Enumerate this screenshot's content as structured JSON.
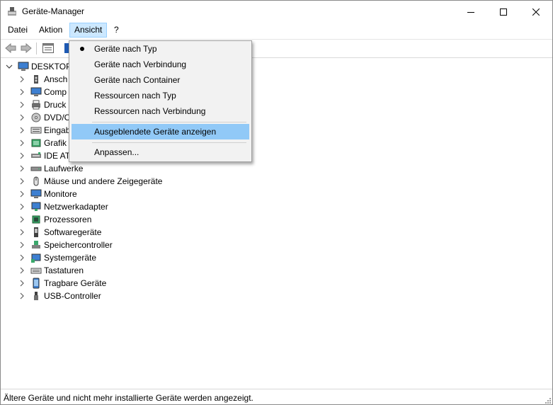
{
  "window": {
    "title": "Geräte-Manager"
  },
  "menubar": {
    "items": [
      "Datei",
      "Aktion",
      "Ansicht",
      "?"
    ]
  },
  "menu_open": {
    "name": "Ansicht",
    "items": [
      {
        "label": "Geräte nach Typ",
        "checked": true
      },
      {
        "label": "Geräte nach Verbindung"
      },
      {
        "label": "Geräte nach Container"
      },
      {
        "label": "Ressourcen nach Typ"
      },
      {
        "label": "Ressourcen nach Verbindung"
      },
      {
        "label": "Ausgeblendete Geräte anzeigen",
        "highlighted": true
      },
      {
        "label": "Anpassen..."
      }
    ]
  },
  "tree": {
    "root": {
      "label": "DESKTOP-",
      "icon": "computer-icon"
    },
    "children": [
      {
        "label": "Ansch",
        "icon": "audio-io-icon"
      },
      {
        "label": "Comp",
        "icon": "monitor-icon"
      },
      {
        "label": "Druck",
        "icon": "printer-icon"
      },
      {
        "label": "DVD/C",
        "icon": "dvd-drive-icon"
      },
      {
        "label": "Eingab",
        "icon": "input-device-icon"
      },
      {
        "label": "Grafik",
        "icon": "display-adapter-icon"
      },
      {
        "label": "IDE AT",
        "icon": "ide-controller-icon"
      },
      {
        "label": "Laufwerke",
        "icon": "disk-drive-icon"
      },
      {
        "label": "Mäuse und andere Zeigegeräte",
        "icon": "mouse-icon"
      },
      {
        "label": "Monitore",
        "icon": "monitor-icon"
      },
      {
        "label": "Netzwerkadapter",
        "icon": "network-adapter-icon"
      },
      {
        "label": "Prozessoren",
        "icon": "processor-icon"
      },
      {
        "label": "Softwaregeräte",
        "icon": "software-device-icon"
      },
      {
        "label": "Speichercontroller",
        "icon": "storage-controller-icon"
      },
      {
        "label": "Systemgeräte",
        "icon": "system-device-icon"
      },
      {
        "label": "Tastaturen",
        "icon": "keyboard-icon"
      },
      {
        "label": "Tragbare Geräte",
        "icon": "portable-device-icon"
      },
      {
        "label": "USB-Controller",
        "icon": "usb-icon"
      }
    ]
  },
  "statusbar": {
    "text": "Ältere Geräte und nicht mehr installierte Geräte werden angezeigt."
  },
  "colors": {
    "menu_highlight": "#91c9f7",
    "menu_active": "#cce8ff",
    "menu_bg": "#f2f2f2"
  }
}
